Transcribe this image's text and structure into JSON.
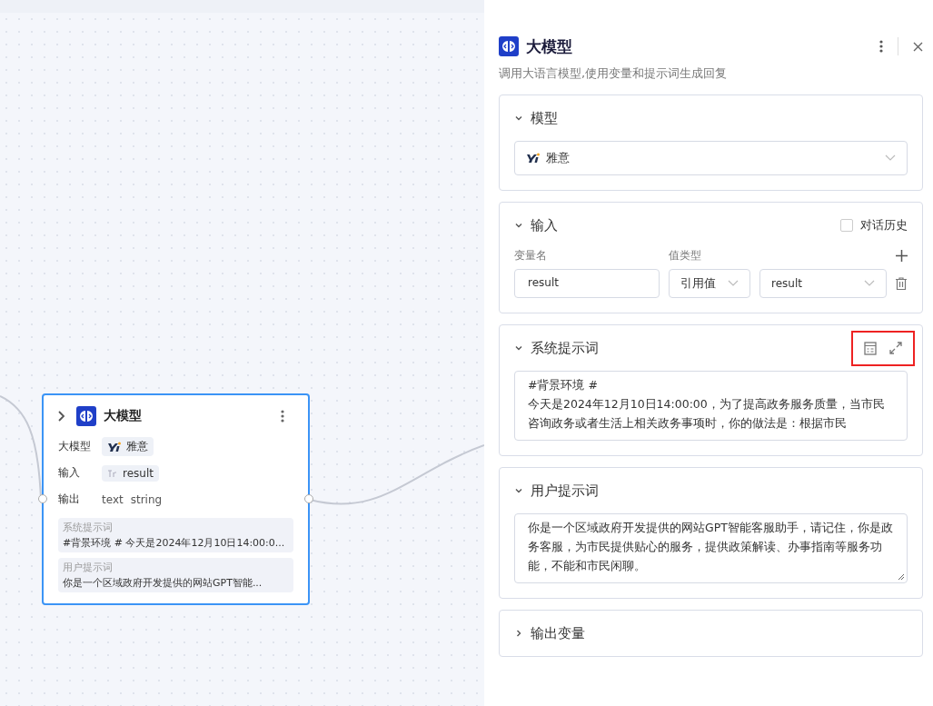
{
  "node": {
    "title": "大模型",
    "selected": true,
    "rows": [
      {
        "kind": "model_tag",
        "label": "大模型",
        "value": "雅意"
      },
      {
        "kind": "string_tag",
        "label": "输入",
        "value": "result"
      },
      {
        "kind": "output",
        "label": "输出",
        "name": "text",
        "type": "string"
      }
    ],
    "previews": [
      {
        "label": "系统提示词",
        "text": "#背景环境 # 今天是2024年12月10日14:00:0..."
      },
      {
        "label": "用户提示词",
        "text": "你是一个区域政府开发提供的网站GPT智能..."
      }
    ]
  },
  "panel": {
    "title": "大模型",
    "description": "调用大语言模型,使用变量和提示词生成回复",
    "sections": [
      {
        "kind": "model",
        "title": "模型",
        "expanded": true,
        "value": "雅意"
      },
      {
        "kind": "input",
        "title": "输入",
        "expanded": true,
        "history": {
          "label": "对话历史",
          "checked": false
        },
        "columns": [
          "变量名",
          "值类型"
        ],
        "rows": [
          {
            "name": "result",
            "type": "引用值",
            "ref": "result"
          }
        ]
      },
      {
        "kind": "system_prompt",
        "title": "系统提示词",
        "expanded": true,
        "highlighted": true,
        "text": "#背景环境 #\n今天是2024年12月10日14:00:00，为了提高政务服务质量，当市民咨询政务或者生活上相关政务事项时，你的做法是：根据市民"
      },
      {
        "kind": "user_prompt",
        "title": "用户提示词",
        "expanded": true,
        "text": "你是一个区域政府开发提供的网站GPT智能客服助手，请记住，你是政务客服，为市民提供贴心的服务，提供政策解读、办事指南等服务功能，不能和市民闲聊。"
      },
      {
        "kind": "collapsed",
        "title": "输出变量",
        "expanded": false
      }
    ]
  }
}
